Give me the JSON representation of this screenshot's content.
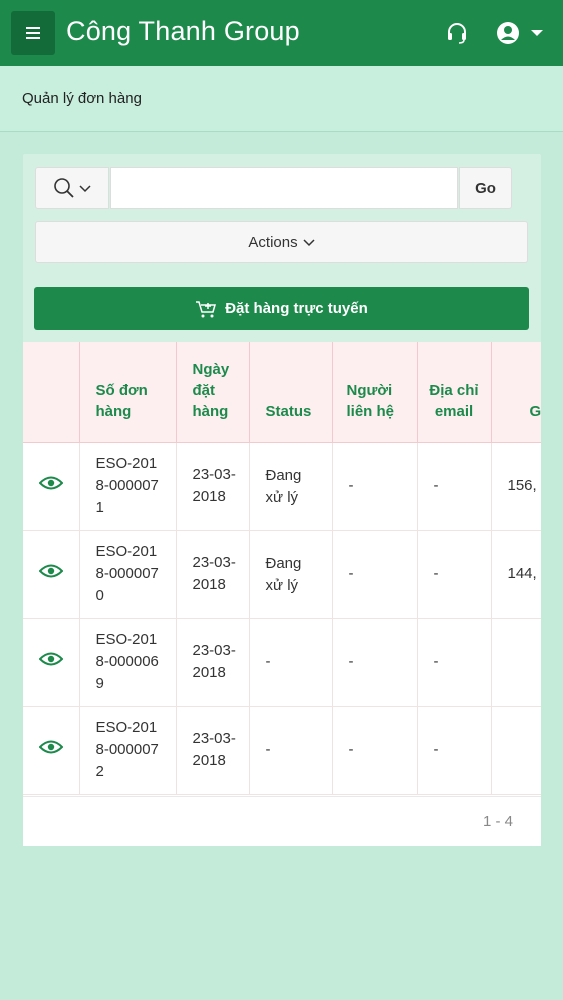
{
  "header": {
    "title": "Công Thanh Group"
  },
  "breadcrumb": {
    "label": "Quản lý đơn hàng"
  },
  "search": {
    "value": "",
    "placeholder": "",
    "go_label": "Go"
  },
  "actions": {
    "label": "Actions"
  },
  "order_button": {
    "label": "Đặt hàng trực tuyến"
  },
  "table": {
    "headers": [
      "",
      "Số đơn hàng",
      "Ngày đặt hàng",
      "Status",
      "Người liên hệ",
      "Địa chỉ email",
      "G"
    ],
    "rows": [
      {
        "so": "ESO-2018-0000071",
        "ngay": "23-03-2018",
        "status": "Đang xử lý",
        "lienhe": "-",
        "email": "-",
        "g": "156,"
      },
      {
        "so": "ESO-2018-0000070",
        "ngay": "23-03-2018",
        "status": "Đang xử lý",
        "lienhe": "-",
        "email": "-",
        "g": "144,"
      },
      {
        "so": "ESO-2018-0000069",
        "ngay": "23-03-2018",
        "status": "-",
        "lienhe": "-",
        "email": "-",
        "g": ""
      },
      {
        "so": "ESO-2018-0000072",
        "ngay": "23-03-2018",
        "status": "-",
        "lienhe": "-",
        "email": "-",
        "g": ""
      }
    ]
  },
  "pagination": {
    "label": "1 - 4"
  },
  "icons": {
    "menu": "hamburger-icon",
    "support": "headset-icon",
    "user": "user-circle-icon",
    "search": "search-icon",
    "cart": "cart-icon",
    "view": "eye-icon"
  },
  "colors": {
    "brand": "#1d8a4c",
    "background": "#c4ebd9",
    "header_bg": "#fdeff0"
  }
}
